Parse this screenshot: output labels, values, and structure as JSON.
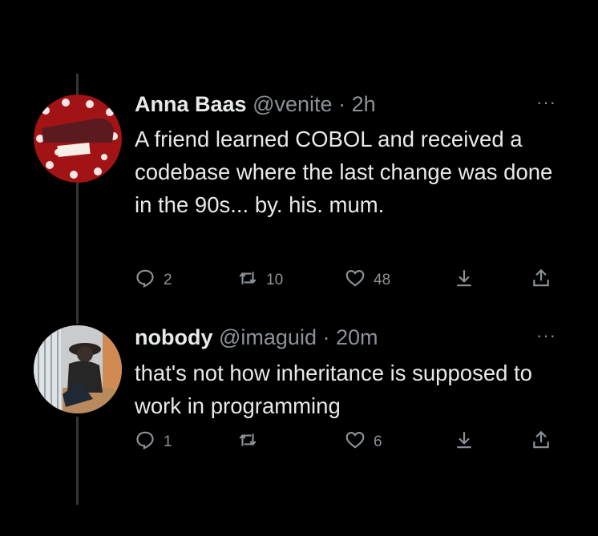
{
  "tweets": [
    {
      "display_name": "Anna Baas",
      "handle": "@venite",
      "separator": "·",
      "time": "2h",
      "more": "···",
      "text": "A friend learned COBOL and received a codebase where the last change was done in the 90s... by. his. mum.",
      "avatar_label": "afro bitters",
      "replies": "2",
      "retweets": "10",
      "likes": "48"
    },
    {
      "display_name": "nobody",
      "handle": "@imaguid",
      "separator": "·",
      "time": "20m",
      "more": "···",
      "text": "that's not how inheritance is supposed to work in programming",
      "replies": "1",
      "retweets": "",
      "likes": "6"
    }
  ],
  "icons": [
    "reply-icon",
    "retweet-icon",
    "like-icon",
    "download-icon",
    "share-icon"
  ],
  "colors": {
    "background": "#000000",
    "text": "#e7e9ea",
    "muted": "#8b9298",
    "thread": "#333639"
  }
}
